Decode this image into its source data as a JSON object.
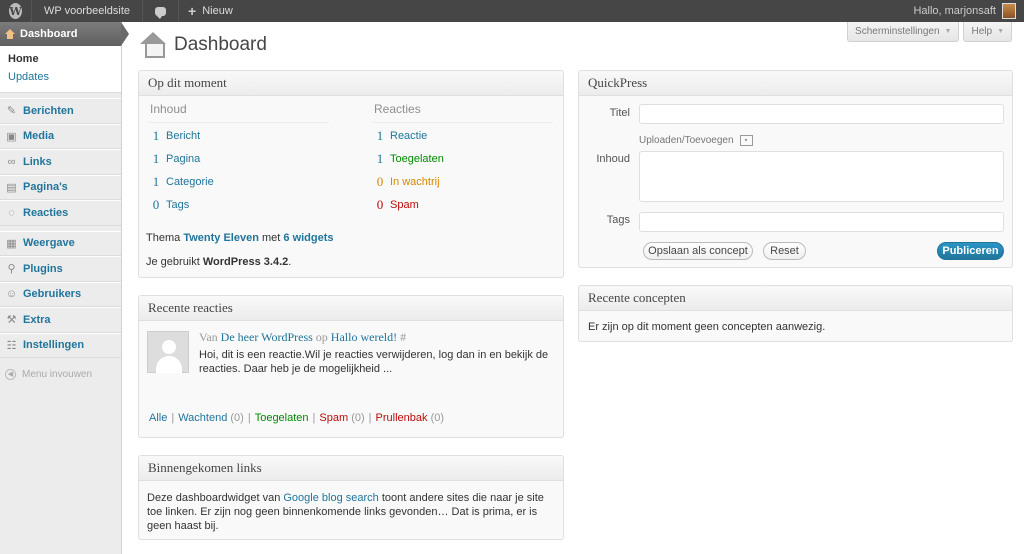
{
  "adminbar": {
    "site_name": "WP voorbeeldsite",
    "new_label": "Nieuw",
    "greeting": "Hallo, marjonsaft"
  },
  "sidebar": {
    "current": "Dashboard",
    "submenu": [
      "Home",
      "Updates"
    ],
    "items": [
      {
        "label": "Berichten",
        "icon": "pin-icon"
      },
      {
        "label": "Media",
        "icon": "media-icon"
      },
      {
        "label": "Links",
        "icon": "links-icon"
      },
      {
        "label": "Pagina's",
        "icon": "pages-icon"
      },
      {
        "label": "Reacties",
        "icon": "comments-icon"
      },
      {
        "label": "Weergave",
        "icon": "appearance-icon"
      },
      {
        "label": "Plugins",
        "icon": "plugins-icon"
      },
      {
        "label": "Gebruikers",
        "icon": "users-icon"
      },
      {
        "label": "Extra",
        "icon": "tools-icon"
      },
      {
        "label": "Instellingen",
        "icon": "settings-icon"
      }
    ],
    "collapse": "Menu invouwen"
  },
  "header": {
    "title": "Dashboard",
    "screen_options": "Scherminstellingen",
    "help": "Help"
  },
  "right_now": {
    "title": "Op dit moment",
    "content_head": "Inhoud",
    "discussion_head": "Reacties",
    "content": [
      {
        "num": "1",
        "label": "Bericht"
      },
      {
        "num": "1",
        "label": "Pagina"
      },
      {
        "num": "1",
        "label": "Categorie"
      },
      {
        "num": "0",
        "label": "Tags"
      }
    ],
    "discussion": [
      {
        "num": "1",
        "label": "Reactie"
      },
      {
        "num": "1",
        "label": "Toegelaten"
      },
      {
        "num": "0",
        "label": "In wachtrij"
      },
      {
        "num": "0",
        "label": "Spam"
      }
    ],
    "theme_prefix": "Thema",
    "theme_name": "Twenty Eleven",
    "theme_mid": "met",
    "widgets": "6 widgets",
    "version_prefix": "Je gebruikt",
    "version": "WordPress 3.4.2",
    "version_suffix": "."
  },
  "recent_comments": {
    "title": "Recente reacties",
    "from": "Van",
    "author": "De heer WordPress",
    "on": "op",
    "post": "Hallo wereld!",
    "hash": "#",
    "excerpt": "Hoi, dit is een reactie.Wil je reacties verwijderen, log dan in en bekijk de reacties. Daar heb je de mogelijkheid ...",
    "filters": {
      "all": "Alle",
      "pending": "Wachtend",
      "pending_count": "(0)",
      "approved": "Toegelaten",
      "spam": "Spam",
      "spam_count": "(0)",
      "trash": "Prullenbak",
      "trash_count": "(0)"
    }
  },
  "incoming_links": {
    "title": "Binnengekomen links",
    "text_before": "Deze dashboardwidget van",
    "link": "Google blog search",
    "text_after": "toont andere sites die naar je site toe linken. Er zijn nog geen binnenkomende links gevonden… Dat is prima, er is geen haast bij."
  },
  "quickpress": {
    "title": "QuickPress",
    "title_label": "Titel",
    "title_value": "",
    "upload_label": "Uploaden/Toevoegen",
    "content_label": "Inhoud",
    "content_value": "",
    "tags_label": "Tags",
    "tags_value": "",
    "save_draft": "Opslaan als concept",
    "reset": "Reset",
    "publish": "Publiceren"
  },
  "recent_drafts": {
    "title": "Recente concepten",
    "empty": "Er zijn op dit moment geen concepten aanwezig."
  },
  "colors": {
    "link": "#21759b",
    "adminbar": "#464646",
    "approved": "#008800",
    "pending": "#d98500",
    "spam": "#bc0b0b"
  }
}
